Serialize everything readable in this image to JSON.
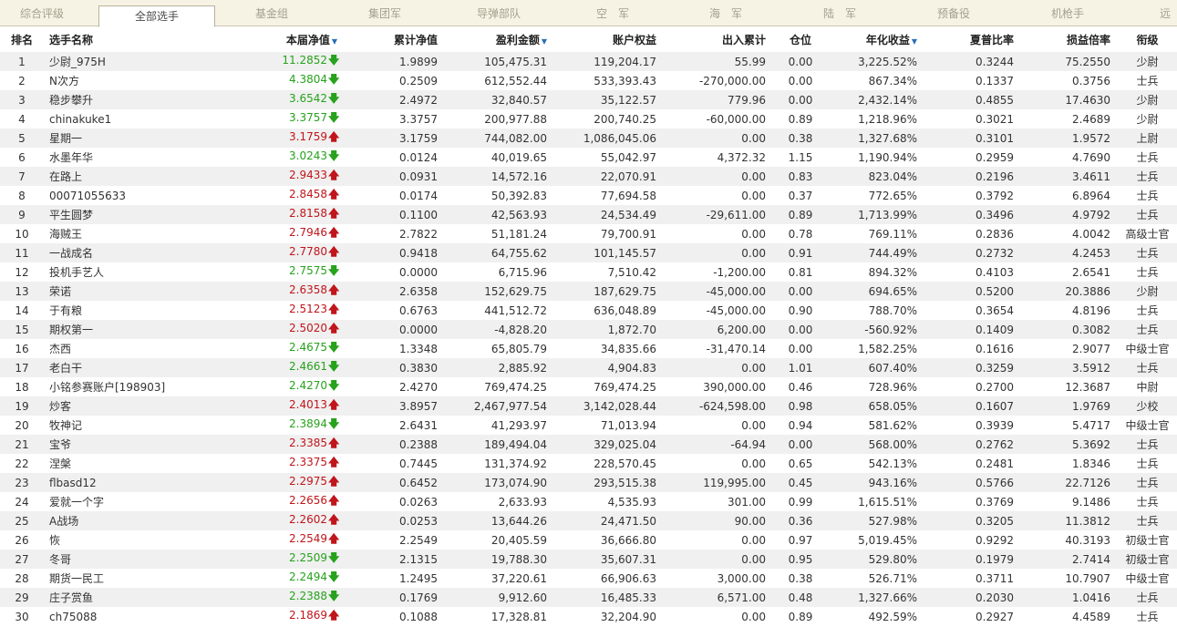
{
  "tabs": [
    {
      "label": "综合评级",
      "active": false
    },
    {
      "label": "全部选手",
      "active": true
    },
    {
      "label": "基金组",
      "active": false
    },
    {
      "label": "集团军",
      "active": false
    },
    {
      "label": "导弹部队",
      "active": false
    },
    {
      "label": "空　军",
      "active": false
    },
    {
      "label": "海　军",
      "active": false
    },
    {
      "label": "陆　军",
      "active": false
    },
    {
      "label": "预备役",
      "active": false
    },
    {
      "label": "机枪手",
      "active": false
    },
    {
      "label": "远",
      "active": false
    }
  ],
  "columns": [
    {
      "label": "排名",
      "sortable": false
    },
    {
      "label": "选手名称",
      "sortable": false
    },
    {
      "label": "本届净值",
      "sortable": true
    },
    {
      "label": "累计净值",
      "sortable": false
    },
    {
      "label": "盈利金额",
      "sortable": true
    },
    {
      "label": "账户权益",
      "sortable": false
    },
    {
      "label": "出入累计",
      "sortable": false
    },
    {
      "label": "仓位",
      "sortable": false
    },
    {
      "label": "年化收益",
      "sortable": true
    },
    {
      "label": "夏普比率",
      "sortable": false
    },
    {
      "label": "损益倍率",
      "sortable": false
    },
    {
      "label": "衔级",
      "sortable": false
    }
  ],
  "sort_marker": "▼",
  "arrows": {
    "up": "🡅",
    "down": "🡇"
  },
  "colors": {
    "up": "#c0151b",
    "down": "#27a21c",
    "tab_bg": "#f7f3e4",
    "row_alt": "#f0f0f0"
  },
  "rows": [
    {
      "rank": "1",
      "name": "少尉_975H",
      "nav": "11.2852",
      "dir": "down",
      "cum": "1.9899",
      "profit": "105,475.31",
      "equity": "119,204.17",
      "flow": "55.99",
      "pos": "0.00",
      "annual": "3,225.52%",
      "sharpe": "0.3244",
      "ratio": "75.2550",
      "rank_title": "少尉"
    },
    {
      "rank": "2",
      "name": "N次方",
      "nav": "4.3804",
      "dir": "down",
      "cum": "0.2509",
      "profit": "612,552.44",
      "equity": "533,393.43",
      "flow": "-270,000.00",
      "pos": "0.00",
      "annual": "867.34%",
      "sharpe": "0.1337",
      "ratio": "0.3756",
      "rank_title": "士兵"
    },
    {
      "rank": "3",
      "name": "稳步攀升",
      "nav": "3.6542",
      "dir": "down",
      "cum": "2.4972",
      "profit": "32,840.57",
      "equity": "35,122.57",
      "flow": "779.96",
      "pos": "0.00",
      "annual": "2,432.14%",
      "sharpe": "0.4855",
      "ratio": "17.4630",
      "rank_title": "少尉"
    },
    {
      "rank": "4",
      "name": "chinakuke1",
      "nav": "3.3757",
      "dir": "down",
      "cum": "3.3757",
      "profit": "200,977.88",
      "equity": "200,740.25",
      "flow": "-60,000.00",
      "pos": "0.89",
      "annual": "1,218.96%",
      "sharpe": "0.3021",
      "ratio": "2.4689",
      "rank_title": "少尉"
    },
    {
      "rank": "5",
      "name": "星期一",
      "nav": "3.1759",
      "dir": "up",
      "cum": "3.1759",
      "profit": "744,082.00",
      "equity": "1,086,045.06",
      "flow": "0.00",
      "pos": "0.38",
      "annual": "1,327.68%",
      "sharpe": "0.3101",
      "ratio": "1.9572",
      "rank_title": "上尉"
    },
    {
      "rank": "6",
      "name": "水墨年华",
      "nav": "3.0243",
      "dir": "down",
      "cum": "0.0124",
      "profit": "40,019.65",
      "equity": "55,042.97",
      "flow": "4,372.32",
      "pos": "1.15",
      "annual": "1,190.94%",
      "sharpe": "0.2959",
      "ratio": "4.7690",
      "rank_title": "士兵"
    },
    {
      "rank": "7",
      "name": "在路上",
      "nav": "2.9433",
      "dir": "up",
      "cum": "0.0931",
      "profit": "14,572.16",
      "equity": "22,070.91",
      "flow": "0.00",
      "pos": "0.83",
      "annual": "823.04%",
      "sharpe": "0.2196",
      "ratio": "3.4611",
      "rank_title": "士兵"
    },
    {
      "rank": "8",
      "name": "00071055633",
      "nav": "2.8458",
      "dir": "up",
      "cum": "0.0174",
      "profit": "50,392.83",
      "equity": "77,694.58",
      "flow": "0.00",
      "pos": "0.37",
      "annual": "772.65%",
      "sharpe": "0.3792",
      "ratio": "6.8964",
      "rank_title": "士兵"
    },
    {
      "rank": "9",
      "name": "平生圆梦",
      "nav": "2.8158",
      "dir": "up",
      "cum": "0.1100",
      "profit": "42,563.93",
      "equity": "24,534.49",
      "flow": "-29,611.00",
      "pos": "0.89",
      "annual": "1,713.99%",
      "sharpe": "0.3496",
      "ratio": "4.9792",
      "rank_title": "士兵"
    },
    {
      "rank": "10",
      "name": "海贼王",
      "nav": "2.7946",
      "dir": "up",
      "cum": "2.7822",
      "profit": "51,181.24",
      "equity": "79,700.91",
      "flow": "0.00",
      "pos": "0.78",
      "annual": "769.11%",
      "sharpe": "0.2836",
      "ratio": "4.0042",
      "rank_title": "高级士官"
    },
    {
      "rank": "11",
      "name": "一战成名",
      "nav": "2.7780",
      "dir": "up",
      "cum": "0.9418",
      "profit": "64,755.62",
      "equity": "101,145.57",
      "flow": "0.00",
      "pos": "0.91",
      "annual": "744.49%",
      "sharpe": "0.2732",
      "ratio": "4.2453",
      "rank_title": "士兵"
    },
    {
      "rank": "12",
      "name": "投机手艺人",
      "nav": "2.7575",
      "dir": "down",
      "cum": "0.0000",
      "profit": "6,715.96",
      "equity": "7,510.42",
      "flow": "-1,200.00",
      "pos": "0.81",
      "annual": "894.32%",
      "sharpe": "0.4103",
      "ratio": "2.6541",
      "rank_title": "士兵"
    },
    {
      "rank": "13",
      "name": "荣诺",
      "nav": "2.6358",
      "dir": "up",
      "cum": "2.6358",
      "profit": "152,629.75",
      "equity": "187,629.75",
      "flow": "-45,000.00",
      "pos": "0.00",
      "annual": "694.65%",
      "sharpe": "0.5200",
      "ratio": "20.3886",
      "rank_title": "少尉"
    },
    {
      "rank": "14",
      "name": "于有粮",
      "nav": "2.5123",
      "dir": "up",
      "cum": "0.6763",
      "profit": "441,512.72",
      "equity": "636,048.89",
      "flow": "-45,000.00",
      "pos": "0.90",
      "annual": "788.70%",
      "sharpe": "0.3654",
      "ratio": "4.8196",
      "rank_title": "士兵"
    },
    {
      "rank": "15",
      "name": "期权第一",
      "nav": "2.5020",
      "dir": "up",
      "cum": "0.0000",
      "profit": "-4,828.20",
      "equity": "1,872.70",
      "flow": "6,200.00",
      "pos": "0.00",
      "annual": "-560.92%",
      "sharpe": "0.1409",
      "ratio": "0.3082",
      "rank_title": "士兵"
    },
    {
      "rank": "16",
      "name": "杰西",
      "nav": "2.4675",
      "dir": "down",
      "cum": "1.3348",
      "profit": "65,805.79",
      "equity": "34,835.66",
      "flow": "-31,470.14",
      "pos": "0.00",
      "annual": "1,582.25%",
      "sharpe": "0.1616",
      "ratio": "2.9077",
      "rank_title": "中级士官"
    },
    {
      "rank": "17",
      "name": "老白干",
      "nav": "2.4661",
      "dir": "down",
      "cum": "0.3830",
      "profit": "2,885.92",
      "equity": "4,904.83",
      "flow": "0.00",
      "pos": "1.01",
      "annual": "607.40%",
      "sharpe": "0.3259",
      "ratio": "3.5912",
      "rank_title": "士兵"
    },
    {
      "rank": "18",
      "name": "小铭参赛账户[198903]",
      "nav": "2.4270",
      "dir": "down",
      "cum": "2.4270",
      "profit": "769,474.25",
      "equity": "769,474.25",
      "flow": "390,000.00",
      "pos": "0.46",
      "annual": "728.96%",
      "sharpe": "0.2700",
      "ratio": "12.3687",
      "rank_title": "中尉"
    },
    {
      "rank": "19",
      "name": "炒客",
      "nav": "2.4013",
      "dir": "up",
      "cum": "3.8957",
      "profit": "2,467,977.54",
      "equity": "3,142,028.44",
      "flow": "-624,598.00",
      "pos": "0.98",
      "annual": "658.05%",
      "sharpe": "0.1607",
      "ratio": "1.9769",
      "rank_title": "少校"
    },
    {
      "rank": "20",
      "name": "牧神记",
      "nav": "2.3894",
      "dir": "down",
      "cum": "2.6431",
      "profit": "41,293.97",
      "equity": "71,013.94",
      "flow": "0.00",
      "pos": "0.94",
      "annual": "581.62%",
      "sharpe": "0.3939",
      "ratio": "5.4717",
      "rank_title": "中级士官"
    },
    {
      "rank": "21",
      "name": "宝爷",
      "nav": "2.3385",
      "dir": "up",
      "cum": "0.2388",
      "profit": "189,494.04",
      "equity": "329,025.04",
      "flow": "-64.94",
      "pos": "0.00",
      "annual": "568.00%",
      "sharpe": "0.2762",
      "ratio": "5.3692",
      "rank_title": "士兵"
    },
    {
      "rank": "22",
      "name": "涅槃",
      "nav": "2.3375",
      "dir": "up",
      "cum": "0.7445",
      "profit": "131,374.92",
      "equity": "228,570.45",
      "flow": "0.00",
      "pos": "0.65",
      "annual": "542.13%",
      "sharpe": "0.2481",
      "ratio": "1.8346",
      "rank_title": "士兵"
    },
    {
      "rank": "23",
      "name": "flbasd12",
      "nav": "2.2975",
      "dir": "up",
      "cum": "0.6452",
      "profit": "173,074.90",
      "equity": "293,515.38",
      "flow": "119,995.00",
      "pos": "0.45",
      "annual": "943.16%",
      "sharpe": "0.5766",
      "ratio": "22.7126",
      "rank_title": "士兵"
    },
    {
      "rank": "24",
      "name": "爱就一个字",
      "nav": "2.2656",
      "dir": "up",
      "cum": "0.0263",
      "profit": "2,633.93",
      "equity": "4,535.93",
      "flow": "301.00",
      "pos": "0.99",
      "annual": "1,615.51%",
      "sharpe": "0.3769",
      "ratio": "9.1486",
      "rank_title": "士兵"
    },
    {
      "rank": "25",
      "name": "A战场",
      "nav": "2.2602",
      "dir": "up",
      "cum": "0.0253",
      "profit": "13,644.26",
      "equity": "24,471.50",
      "flow": "90.00",
      "pos": "0.36",
      "annual": "527.98%",
      "sharpe": "0.3205",
      "ratio": "11.3812",
      "rank_title": "士兵"
    },
    {
      "rank": "26",
      "name": "恢",
      "nav": "2.2549",
      "dir": "up",
      "cum": "2.2549",
      "profit": "20,405.59",
      "equity": "36,666.80",
      "flow": "0.00",
      "pos": "0.97",
      "annual": "5,019.45%",
      "sharpe": "0.9292",
      "ratio": "40.3193",
      "rank_title": "初级士官"
    },
    {
      "rank": "27",
      "name": "冬哥",
      "nav": "2.2509",
      "dir": "down",
      "cum": "2.1315",
      "profit": "19,788.30",
      "equity": "35,607.31",
      "flow": "0.00",
      "pos": "0.95",
      "annual": "529.80%",
      "sharpe": "0.1979",
      "ratio": "2.7414",
      "rank_title": "初级士官"
    },
    {
      "rank": "28",
      "name": "期货一民工",
      "nav": "2.2494",
      "dir": "down",
      "cum": "1.2495",
      "profit": "37,220.61",
      "equity": "66,906.63",
      "flow": "3,000.00",
      "pos": "0.38",
      "annual": "526.71%",
      "sharpe": "0.3711",
      "ratio": "10.7907",
      "rank_title": "中级士官"
    },
    {
      "rank": "29",
      "name": "庄子赏鱼",
      "nav": "2.2388",
      "dir": "down",
      "cum": "0.1769",
      "profit": "9,912.60",
      "equity": "16,485.33",
      "flow": "6,571.00",
      "pos": "0.48",
      "annual": "1,327.66%",
      "sharpe": "0.2030",
      "ratio": "1.0416",
      "rank_title": "士兵"
    },
    {
      "rank": "30",
      "name": "ch75088",
      "nav": "2.1869",
      "dir": "up",
      "cum": "0.1088",
      "profit": "17,328.81",
      "equity": "32,204.90",
      "flow": "0.00",
      "pos": "0.89",
      "annual": "492.59%",
      "sharpe": "0.2927",
      "ratio": "4.4589",
      "rank_title": "士兵"
    }
  ]
}
